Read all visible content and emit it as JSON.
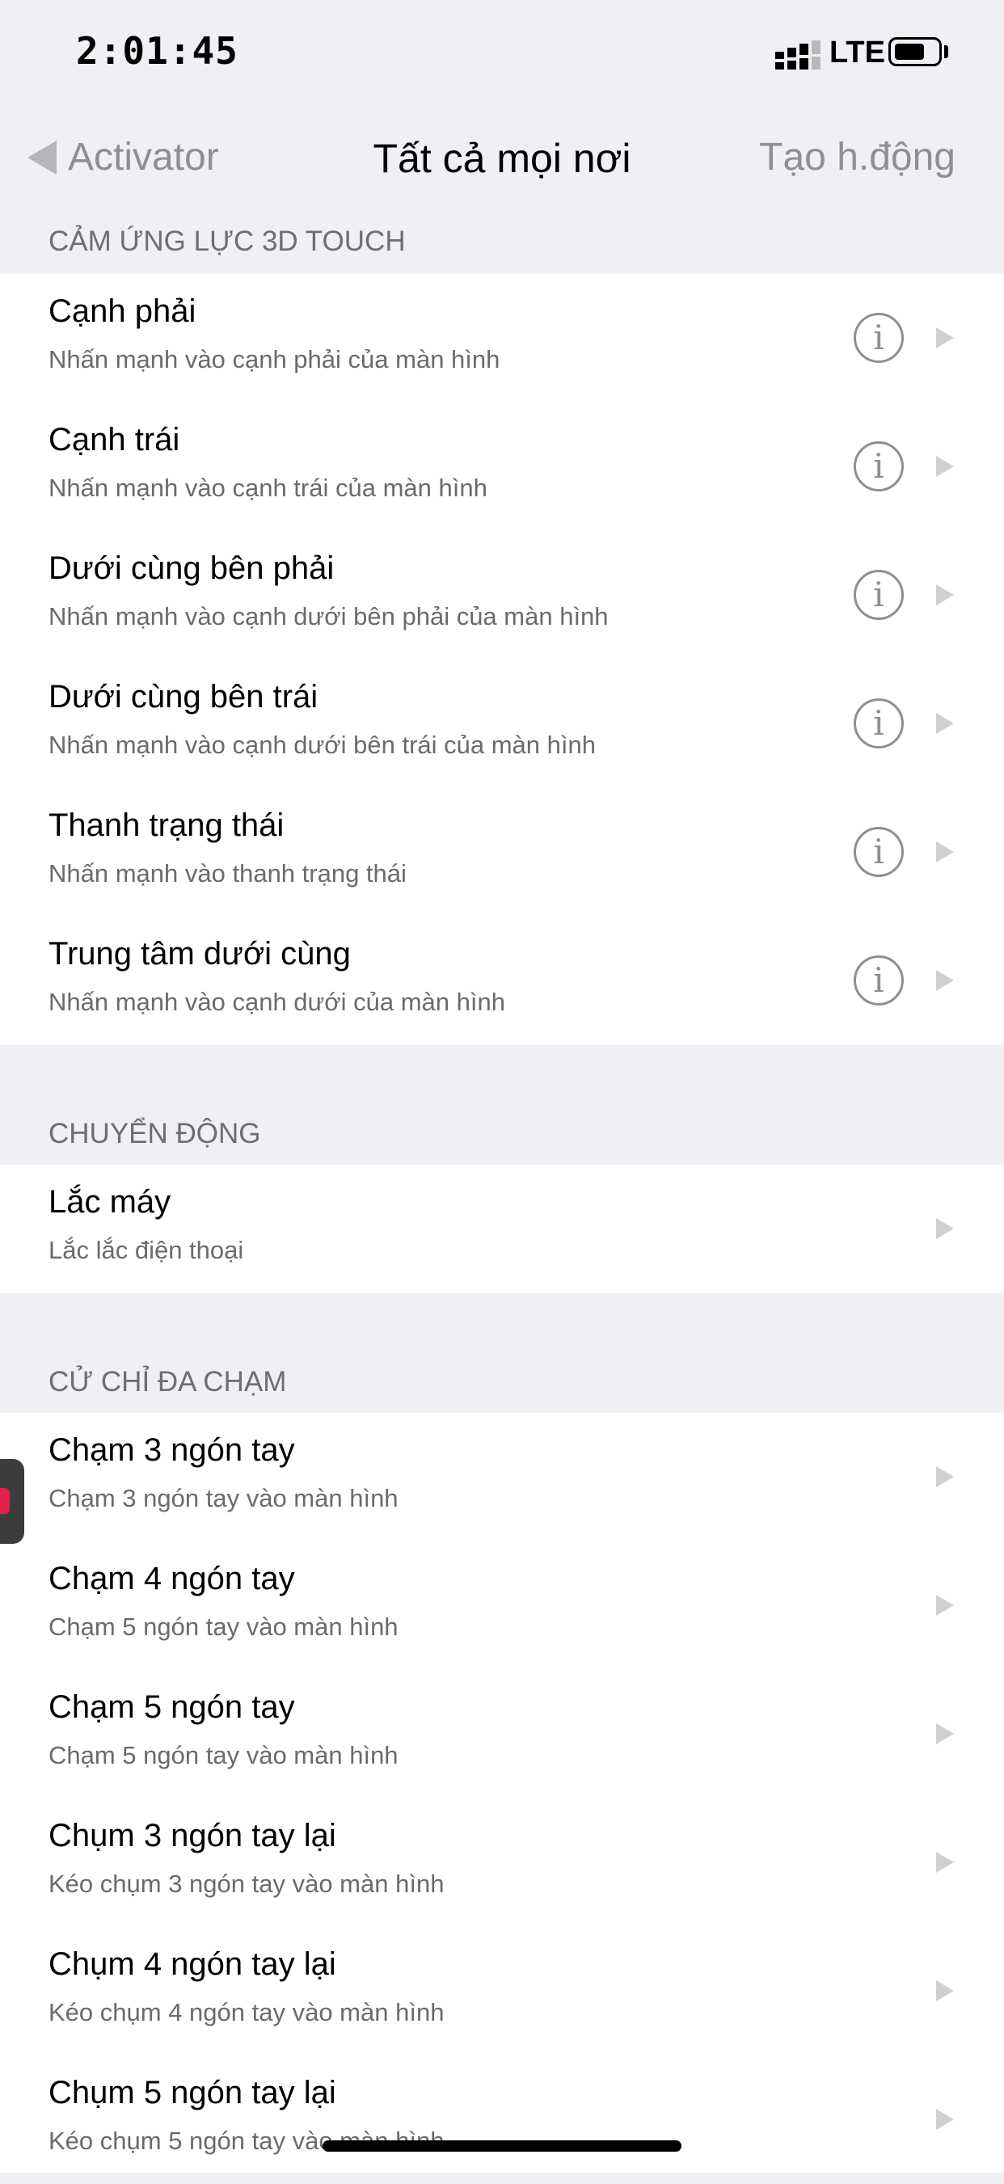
{
  "status_bar": {
    "time": "2:01:45",
    "network": "LTE"
  },
  "nav": {
    "back_label": "Activator",
    "title": "Tất cả mọi nơi",
    "action_label": "Tạo h.động"
  },
  "sections": [
    {
      "header": "CẢM ỨNG LỰC 3D TOUCH",
      "rows": [
        {
          "title": "Cạnh phải",
          "subtitle": "Nhấn mạnh vào cạnh phải của màn hình",
          "info": true
        },
        {
          "title": "Cạnh trái",
          "subtitle": "Nhấn mạnh vào cạnh trái của màn hình",
          "info": true
        },
        {
          "title": "Dưới cùng bên phải",
          "subtitle": "Nhấn mạnh vào cạnh dưới bên phải của màn hình",
          "info": true
        },
        {
          "title": "Dưới cùng bên trái",
          "subtitle": "Nhấn mạnh vào cạnh dưới bên trái của màn hình",
          "info": true
        },
        {
          "title": "Thanh trạng thái",
          "subtitle": "Nhấn mạnh vào thanh trạng thái",
          "info": true
        },
        {
          "title": "Trung tâm dưới cùng",
          "subtitle": "Nhấn mạnh vào cạnh dưới của màn hình",
          "info": true
        }
      ]
    },
    {
      "header": "CHUYỂN ĐỘNG",
      "rows": [
        {
          "title": "Lắc máy",
          "subtitle": "Lắc lắc điện thoại",
          "info": false
        }
      ]
    },
    {
      "header": "CỬ CHỈ ĐA CHẠM",
      "rows": [
        {
          "title": "Chạm 3 ngón tay",
          "subtitle": "Chạm 3 ngón tay vào màn hình",
          "info": false
        },
        {
          "title": "Chạm 4 ngón tay",
          "subtitle": "Chạm 5 ngón tay vào màn hình",
          "info": false
        },
        {
          "title": "Chạm 5 ngón tay",
          "subtitle": "Chạm 5 ngón tay vào màn hình",
          "info": false
        },
        {
          "title": "Chụm 3 ngón tay lại",
          "subtitle": "Kéo chụm 3 ngón tay vào màn hình",
          "info": false
        },
        {
          "title": "Chụm 4 ngón tay lại",
          "subtitle": "Kéo chụm 4 ngón tay vào màn hình",
          "info": false
        },
        {
          "title": "Chụm 5 ngón tay lại",
          "subtitle": "Kéo chụm 5 ngón tay vào màn hình",
          "info": false
        }
      ]
    }
  ],
  "icons": {
    "info": "info-circle-icon",
    "chevron": "chevron-right-icon",
    "back": "back-arrow-icon"
  },
  "colors": {
    "background": "#efeff4",
    "cell": "#ffffff",
    "secondary_text": "#8e8e93",
    "chevron": "#cfcfd4"
  }
}
